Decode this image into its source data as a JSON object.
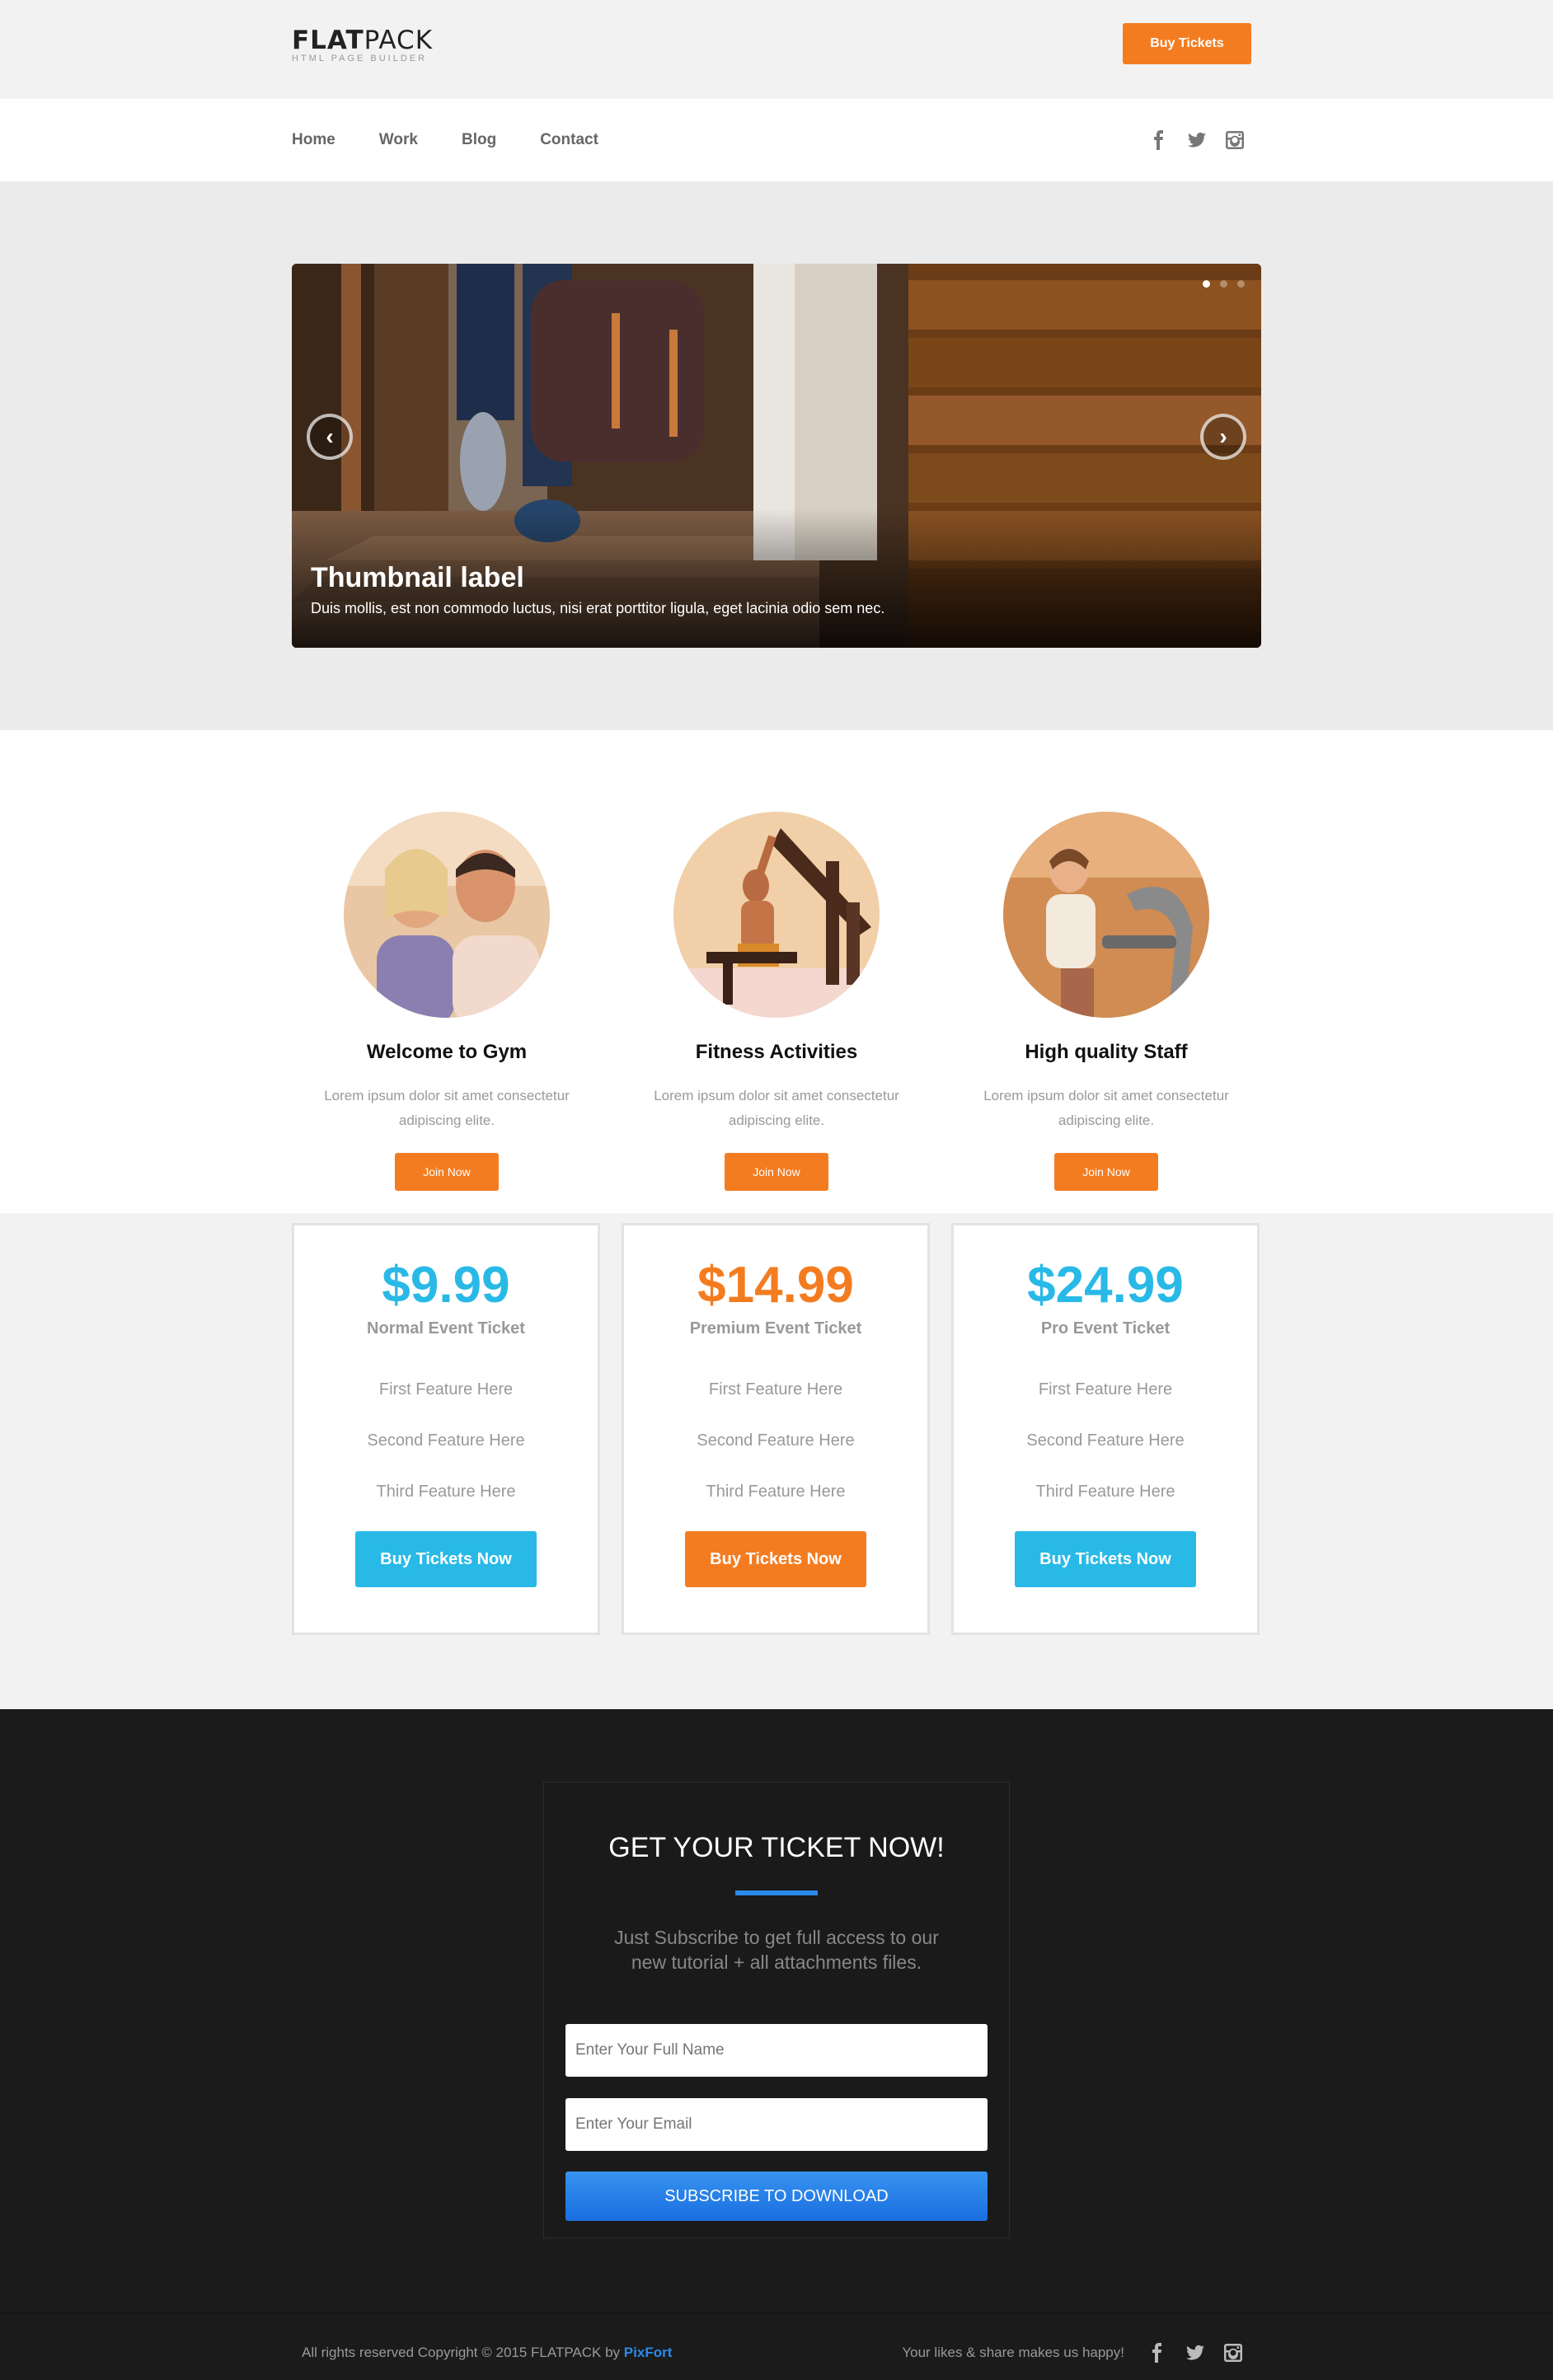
{
  "brand": {
    "logo_bold": "FLAT",
    "logo_light": "PACK",
    "tagline": "HTML PAGE BUILDER"
  },
  "topbar": {
    "cta_label": "Buy Tickets"
  },
  "nav": {
    "links": [
      "Home",
      "Work",
      "Blog",
      "Contact"
    ],
    "social_icons": [
      "facebook-icon",
      "twitter-icon",
      "instagram-icon"
    ]
  },
  "slider": {
    "title": "Thumbnail label",
    "text": "Duis mollis, est non commodo luctus, nisi erat porttitor ligula, eget lacinia odio sem nec.",
    "prev_icon": "chevron-left-icon",
    "next_icon": "chevron-right-icon",
    "slide_count": 3,
    "active_slide": 1
  },
  "features": [
    {
      "title": "Welcome to Gym",
      "text": "Lorem ipsum dolor sit amet consectetur adipiscing elite.",
      "button": "Join Now"
    },
    {
      "title": "Fitness Activities",
      "text": "Lorem ipsum dolor sit amet consectetur adipiscing elite.",
      "button": "Join Now"
    },
    {
      "title": "High quality Staff",
      "text": "Lorem ipsum dolor sit amet consectetur adipiscing elite.",
      "button": "Join Now"
    }
  ],
  "pricing": [
    {
      "price": "$9.99",
      "name": "Normal Event Ticket",
      "features": [
        "First Feature Here",
        "Second Feature Here",
        "Third Feature Here"
      ],
      "button": "Buy Tickets Now",
      "color": "#29b9e6"
    },
    {
      "price": "$14.99",
      "name": "Premium Event Ticket",
      "features": [
        "First Feature Here",
        "Second Feature Here",
        "Third Feature Here"
      ],
      "button": "Buy Tickets Now",
      "color": "#f47c20"
    },
    {
      "price": "$24.99",
      "name": "Pro Event Ticket",
      "features": [
        "First Feature Here",
        "Second Feature Here",
        "Third Feature Here"
      ],
      "button": "Buy Tickets Now",
      "color": "#29b9e6"
    }
  ],
  "subscribe": {
    "title": "GET YOUR TICKET NOW!",
    "text": "Just Subscribe to get full access to our new tutorial + all attachments files.",
    "name_placeholder": "Enter Your Full Name",
    "email_placeholder": "Enter Your Email",
    "button": "SUBSCRIBE TO DOWNLOAD"
  },
  "footer": {
    "copyright": "All rights reserved Copyright © 2015 FLATPACK by",
    "copyright_brand": "PixFort",
    "likes": "Your likes & share makes us happy!",
    "social_icons": [
      "facebook-icon",
      "twitter-icon",
      "instagram-icon"
    ]
  },
  "colors": {
    "orange": "#f47c20",
    "cyan": "#29b9e6",
    "blue": "#2b8ae8",
    "dark": "#1b1b1b"
  }
}
